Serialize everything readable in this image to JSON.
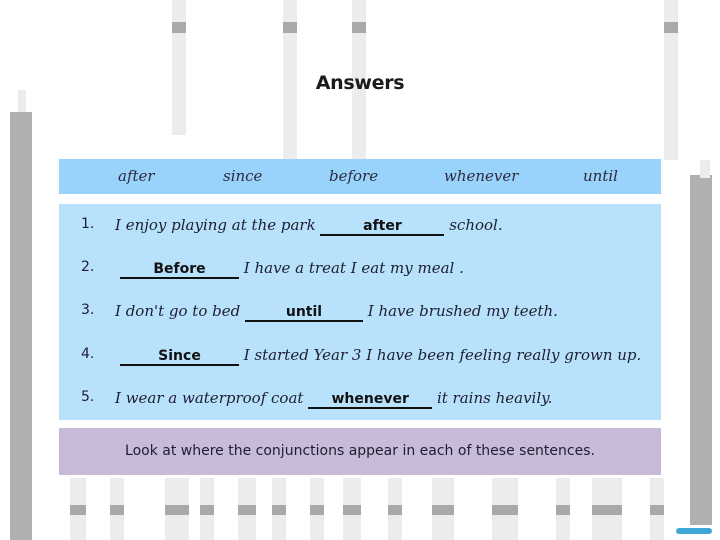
{
  "title": "Answers",
  "word_bank": [
    "after",
    "since",
    "before",
    "whenever",
    "until"
  ],
  "sentences": [
    {
      "number": "1.",
      "before": "I enjoy playing at the park ",
      "answer": "after",
      "after": " school."
    },
    {
      "number": "2.",
      "before": "",
      "answer": "Before",
      "after": " I have a treat I eat my meal ."
    },
    {
      "number": "3.",
      "before": "I don't go to bed ",
      "answer": "until",
      "after": " I have brushed my teeth."
    },
    {
      "number": "4.",
      "before": "",
      "answer": "Since",
      "after": " I started Year 3 I have been feeling really grown up."
    },
    {
      "number": "5.",
      "before": "I wear a waterproof coat ",
      "answer": "whenever",
      "after": " it rains heavily."
    }
  ],
  "tip": "Look at where the conjunctions appear in each of these sentences.",
  "colors": {
    "word_bank_bg": "#99d3fb",
    "sentences_bg": "#b8e2fc",
    "tip_bg": "#c8bbd9"
  },
  "logo": {
    "icon": "publisher-logo-icon"
  }
}
